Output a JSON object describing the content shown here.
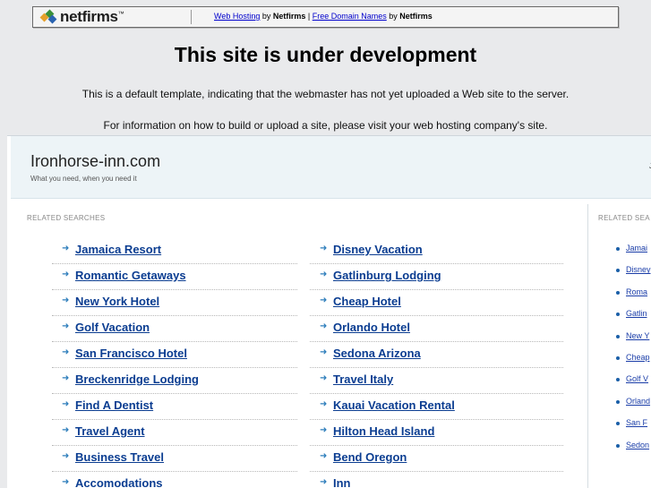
{
  "banner": {
    "logo_text": "netfirms",
    "logo_tm": "™",
    "link1": "Web Hosting",
    "by1": " by ",
    "brand1": "Netfirms",
    "pipe": " | ",
    "link2": "Free Domain Names",
    "by2": " by ",
    "brand2": "Netfirms"
  },
  "notice": {
    "title": "This site is under development",
    "line1": "This is a default template, indicating that the webmaster has not yet uploaded a Web site to the server.",
    "line2": "For information on how to build or upload a site, please visit your web hosting company's site."
  },
  "site": {
    "name": "Ironhorse-inn.com",
    "tagline": "What you need, when you need it",
    "header_right": "J"
  },
  "related": {
    "label": "RELATED SEARCHES",
    "label_right": "RELATED SEA",
    "col1": [
      "Jamaica Resort",
      "Romantic Getaways",
      "New York Hotel",
      "Golf Vacation",
      "San Francisco Hotel",
      "Breckenridge Lodging",
      "Find A Dentist",
      "Travel Agent",
      "Business Travel",
      "Accomodations"
    ],
    "col2": [
      "Disney Vacation",
      "Gatlinburg Lodging",
      "Cheap Hotel",
      "Orlando Hotel",
      "Sedona Arizona",
      "Travel Italy",
      "Kauai Vacation Rental",
      "Hilton Head Island",
      "Bend Oregon",
      "Inn"
    ],
    "right": [
      "Jamai",
      "Disney",
      "Roma",
      "Gatlin",
      "New Y",
      "Cheap",
      "Golf V",
      "Orland",
      "San F",
      "Sedon"
    ]
  },
  "colors": {
    "link": "#0b3d91",
    "arrow": "#2d7dbb",
    "header_bg": "#edf4f7",
    "page_bg": "#e9eaec"
  },
  "icons": {
    "list_arrow": "arrow-right-icon",
    "right_bullet": "bullet-icon"
  }
}
